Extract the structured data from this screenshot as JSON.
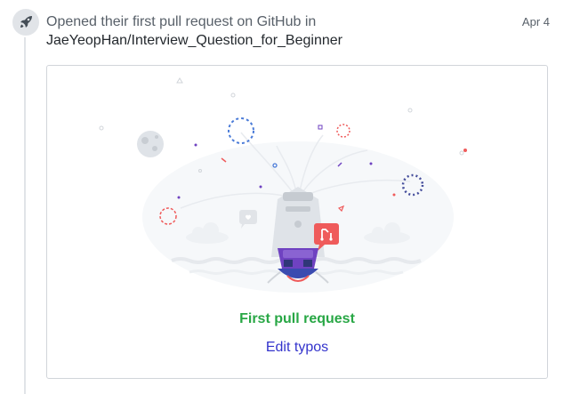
{
  "event": {
    "prefix": "Opened their first pull request on GitHub in",
    "repository": "JaeYeopHan/Interview_Question_for_Beginner",
    "date": "Apr 4",
    "badge_icon": "rocket-icon"
  },
  "card": {
    "title": "First pull request",
    "link": "Edit typos",
    "illustration": "ship-launch-illustration"
  },
  "colors": {
    "title_green": "#28a745",
    "link_blue": "#3333cc",
    "accent_red": "#ef5b5b",
    "accent_purple": "#6f42c1"
  }
}
